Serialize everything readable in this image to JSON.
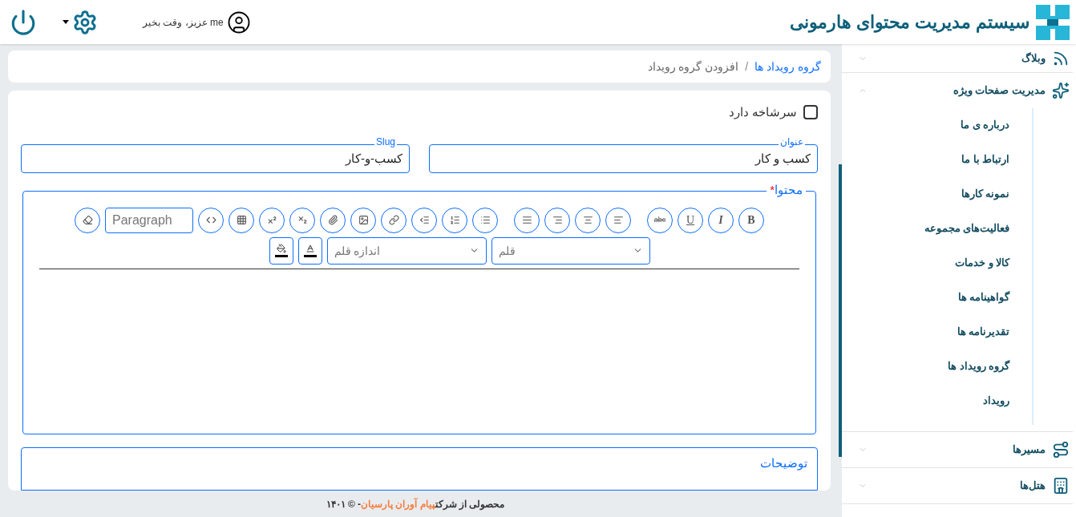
{
  "header": {
    "title": "سیستم مدیریت محتوای هارمونی",
    "greeting": "me عزیز، وقت بخیر"
  },
  "breadcrumb": {
    "separator": "/",
    "items": [
      {
        "label": "گروه رویداد ها",
        "link": true
      },
      {
        "label": "افزودن گروه رویداد",
        "link": false
      }
    ]
  },
  "form": {
    "has_parent": {
      "label": "سرشاخه دارد",
      "checked": false
    },
    "fields": [
      {
        "label": "عنوان",
        "value": "کسب و کار"
      },
      {
        "label": "Slug",
        "value": "کسب-و-کار"
      }
    ],
    "content": {
      "label": "محتوا",
      "required": "*",
      "toolbar": [
        {
          "kind": "bold",
          "text": "B"
        },
        {
          "kind": "italic",
          "text": "I"
        },
        {
          "kind": "underline",
          "text": "U"
        },
        {
          "kind": "strike",
          "text": "abc"
        },
        {
          "kind": "gap"
        },
        {
          "kind": "align-left"
        },
        {
          "kind": "align-center"
        },
        {
          "kind": "align-right"
        },
        {
          "kind": "justify"
        },
        {
          "kind": "gap"
        },
        {
          "kind": "bullet-list"
        },
        {
          "kind": "numbered-list"
        },
        {
          "kind": "outdent"
        },
        {
          "kind": "link"
        },
        {
          "kind": "image"
        },
        {
          "kind": "attach"
        },
        {
          "kind": "subscript"
        },
        {
          "kind": "superscript"
        },
        {
          "kind": "table"
        },
        {
          "kind": "code"
        },
        {
          "kind": "format",
          "text": "Paragraph"
        },
        {
          "kind": "eraser"
        }
      ],
      "toolbar_row2": [
        {
          "kind": "font",
          "text": "قلم"
        },
        {
          "kind": "size",
          "text": "اندازه قلم"
        },
        {
          "kind": "text-color"
        },
        {
          "kind": "fill-color"
        }
      ]
    },
    "description": {
      "label": "توضیحات"
    }
  },
  "footer": {
    "before": "محصولی از شرکت",
    "link": "پیام آوران پارسیان",
    "after": "- © ۱۴۰۱"
  },
  "sidebar": [
    {
      "label": "وبلاگ",
      "expanded": false
    },
    {
      "label": "مدیریت صفحات ویژه",
      "expanded": true,
      "children": [
        {
          "label": "درباره ی ما"
        },
        {
          "label": "ارتباط با ما"
        },
        {
          "label": "نمونه کارها"
        },
        {
          "label": "فعالیت‌های مجموعه"
        },
        {
          "label": "کالا و خدمات"
        },
        {
          "label": "گواهینامه ها"
        },
        {
          "label": "تقدیرنامه ها"
        },
        {
          "label": "گروه رویداد ها"
        },
        {
          "label": "رویداد"
        }
      ]
    },
    {
      "label": "مسیرها",
      "expanded": false
    },
    {
      "label": "هتل‌ها",
      "expanded": false
    }
  ]
}
